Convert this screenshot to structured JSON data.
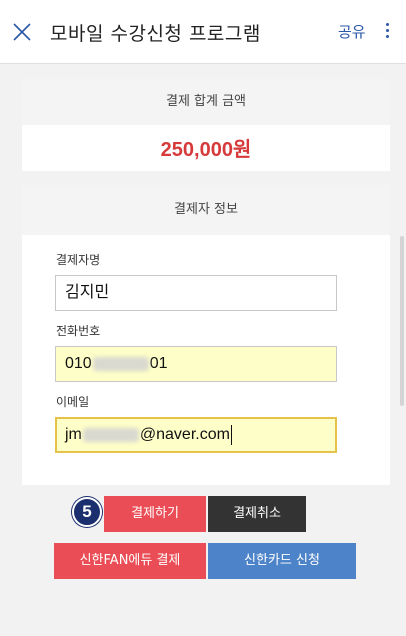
{
  "header": {
    "title": "모바일 수강신청 프로그램",
    "share_label": "공유"
  },
  "total": {
    "heading": "결제 합계 금액",
    "amount": "250,000원"
  },
  "payer": {
    "heading": "결제자 정보",
    "name_label": "결제자명",
    "name_value": "김지민",
    "phone_label": "전화번호",
    "phone_prefix": "010",
    "phone_suffix": "01",
    "email_label": "이메일",
    "email_prefix": "jm",
    "email_suffix": "@naver.com"
  },
  "actions": {
    "step_number": "5",
    "pay_label": "결제하기",
    "cancel_label": "결제취소",
    "shinhan_fan_label": "신한FAN에듀 결제",
    "shinhan_card_label": "신한카드 신청"
  },
  "colors": {
    "accent_red": "#ea4d55",
    "amount_red": "#d63a3a",
    "accent_blue": "#4d83c9",
    "link_blue": "#2b57a8",
    "badge_navy": "#1b2f6e"
  },
  "icons": {
    "close": "close-icon",
    "more": "more-vertical-icon"
  }
}
